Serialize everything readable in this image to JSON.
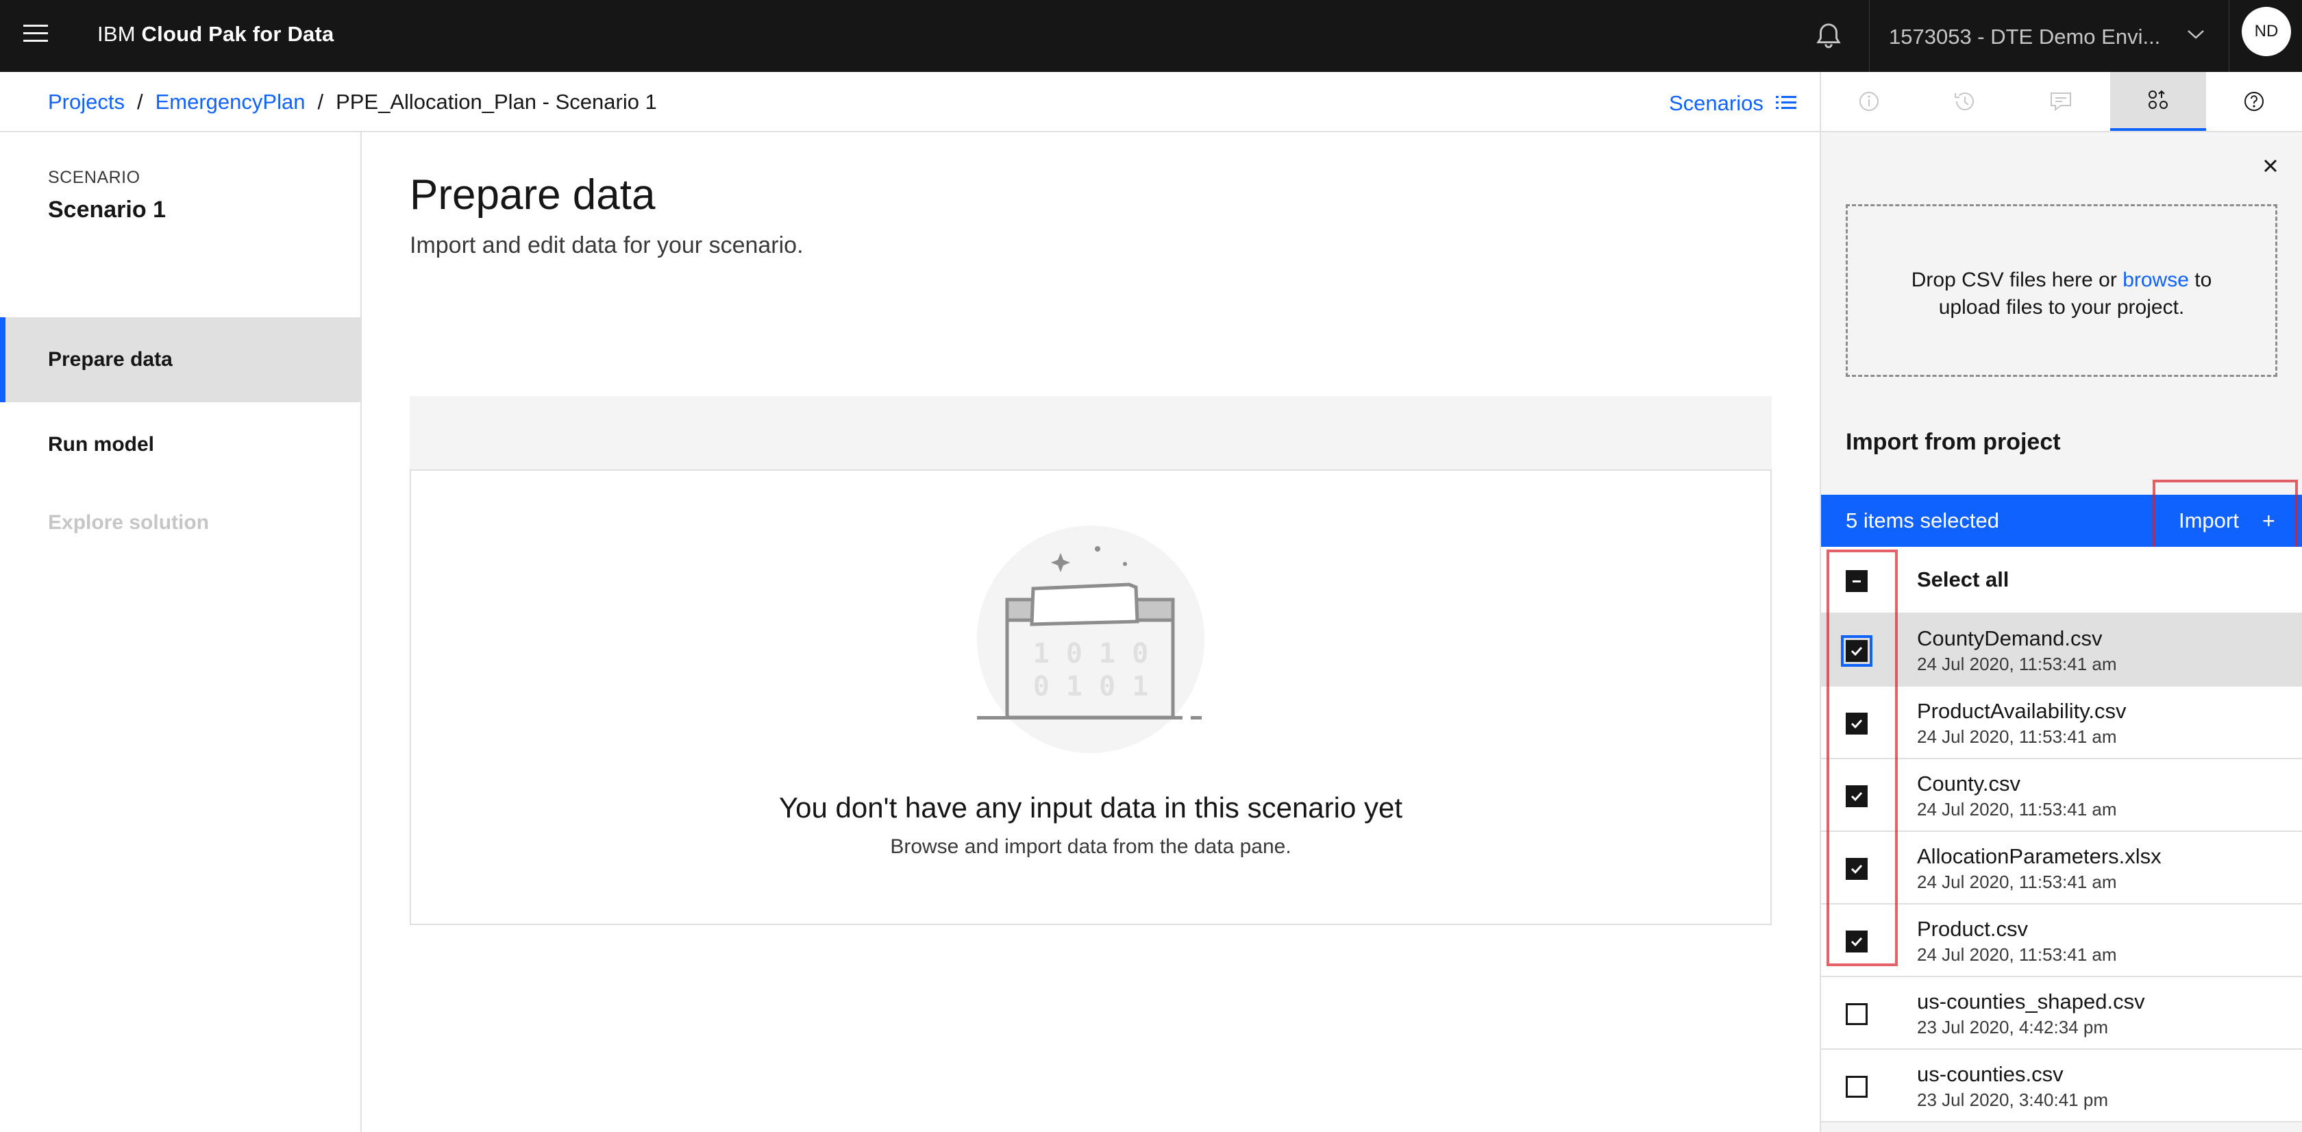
{
  "header": {
    "brand_prefix": "IBM",
    "brand_name": "Cloud Pak for Data",
    "environment": "1573053 - DTE Demo Envi...",
    "avatar_initials": "ND"
  },
  "breadcrumb": {
    "items": [
      "Projects",
      "EmergencyPlan"
    ],
    "current": "PPE_Allocation_Plan - Scenario 1",
    "separator": "/"
  },
  "scenarios_button": "Scenarios",
  "sidebar": {
    "section_label": "SCENARIO",
    "scenario_name": "Scenario 1",
    "nav": [
      "Prepare data",
      "Run model",
      "Explore solution"
    ]
  },
  "main": {
    "title": "Prepare data",
    "subtitle": "Import and edit data for your scenario.",
    "empty_title": "You don't have any input data in this scenario yet",
    "empty_sub": "Browse and import data from the data pane.",
    "illus_line1": "1 0 1 0",
    "illus_line2": "0 1 0 1"
  },
  "panel": {
    "drop_prefix": "Drop CSV files here or ",
    "drop_link": "browse",
    "drop_suffix": " to",
    "drop_line2": "upload files to your project.",
    "import_title": "Import from project",
    "selected_text": "5 items selected",
    "import_label": "Import",
    "import_plus": "+",
    "select_all": "Select all",
    "files": [
      {
        "name": "CountyDemand.csv",
        "date": "24 Jul 2020, 11:53:41 am",
        "checked": true
      },
      {
        "name": "ProductAvailability.csv",
        "date": "24 Jul 2020, 11:53:41 am",
        "checked": true
      },
      {
        "name": "County.csv",
        "date": "24 Jul 2020, 11:53:41 am",
        "checked": true
      },
      {
        "name": "AllocationParameters.xlsx",
        "date": "24 Jul 2020, 11:53:41 am",
        "checked": true
      },
      {
        "name": "Product.csv",
        "date": "24 Jul 2020, 11:53:41 am",
        "checked": true
      },
      {
        "name": "us-counties_shaped.csv",
        "date": "23 Jul 2020, 4:42:34 pm",
        "checked": false
      },
      {
        "name": "us-counties.csv",
        "date": "23 Jul 2020, 3:40:41 pm",
        "checked": false
      }
    ]
  },
  "colors": {
    "accent": "#0f62fe",
    "header_bg": "#161616",
    "highlight": "#da1e28"
  }
}
